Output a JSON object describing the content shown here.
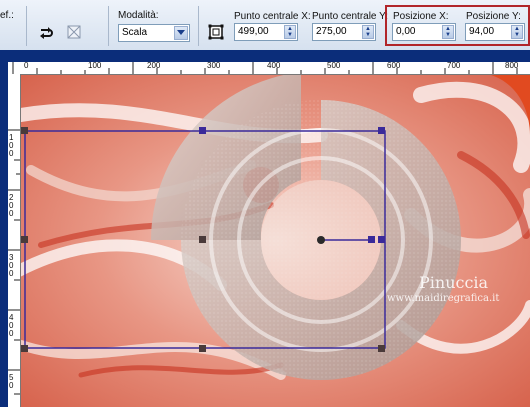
{
  "toolbar": {
    "preset_label": "ef.:",
    "mode": {
      "label": "Modalità:",
      "value": "Scala"
    },
    "center_x": {
      "label": "Punto centrale X:",
      "value": "499,00"
    },
    "center_y": {
      "label": "Punto centrale Y:",
      "value": "275,00"
    },
    "pos_x": {
      "label": "Posizione X:",
      "value": "0,00"
    },
    "pos_y": {
      "label": "Posizione Y:",
      "value": "94,00"
    }
  },
  "ruler_top": [
    "0",
    "100",
    "200",
    "300",
    "400",
    "500",
    "600",
    "700",
    "800"
  ],
  "ruler_left": [
    "1 0 0",
    "2 0 0",
    "3 0 0",
    "4 0 0",
    "5 0"
  ],
  "watermark": {
    "name": "Pinuccia",
    "url": "www.maidiregrafica.it"
  },
  "colors": {
    "highlight": "#b1262a",
    "selection": "#3a2a9a",
    "toolbar": "#dfe8f4"
  }
}
